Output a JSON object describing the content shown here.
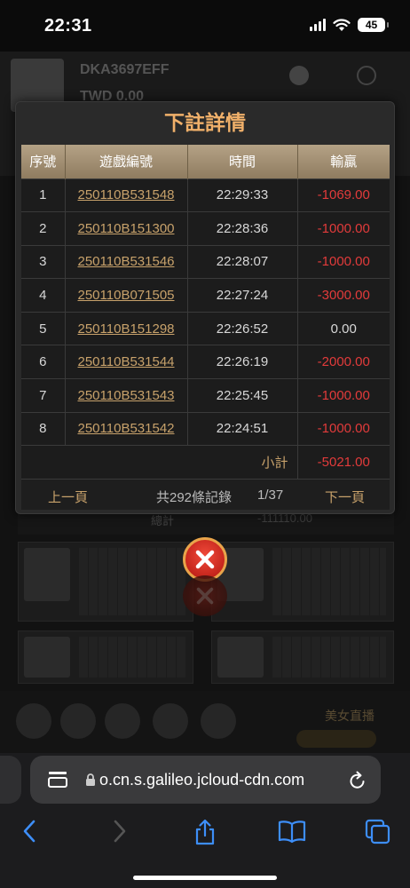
{
  "status_bar": {
    "time": "22:31",
    "battery": "45"
  },
  "background": {
    "username": "DKA3697EFF",
    "balance": "TWD 0.00",
    "total_label": "總計",
    "total_value": "-111110.00",
    "live_label": "美女直播"
  },
  "modal": {
    "title": "下註詳情",
    "columns": [
      "序號",
      "遊戲編號",
      "時間",
      "輸贏"
    ],
    "rows": [
      {
        "no": "1",
        "game_id": "250110B531548",
        "time": "22:29:33",
        "result": "-1069.00"
      },
      {
        "no": "2",
        "game_id": "250110B151300",
        "time": "22:28:36",
        "result": "-1000.00"
      },
      {
        "no": "3",
        "game_id": "250110B531546",
        "time": "22:28:07",
        "result": "-1000.00"
      },
      {
        "no": "4",
        "game_id": "250110B071505",
        "time": "22:27:24",
        "result": "-3000.00"
      },
      {
        "no": "5",
        "game_id": "250110B151298",
        "time": "22:26:52",
        "result": "0.00"
      },
      {
        "no": "6",
        "game_id": "250110B531544",
        "time": "22:26:19",
        "result": "-2000.00"
      },
      {
        "no": "7",
        "game_id": "250110B531543",
        "time": "22:25:45",
        "result": "-1000.00"
      },
      {
        "no": "8",
        "game_id": "250110B531542",
        "time": "22:24:51",
        "result": "-1000.00"
      }
    ],
    "subtotal_label": "小計",
    "subtotal_value": "-5021.00",
    "pager": {
      "prev": "上一頁",
      "total_records": "共292條記錄",
      "page": "1/37",
      "next": "下一頁"
    }
  },
  "browser": {
    "url": "o.cn.s.galileo.jcloud-cdn.com"
  },
  "colors": {
    "accent_gold": "#c8a26b",
    "title_orange": "#f0b06a",
    "negative_red": "#e23b3b",
    "header_bg": "#a08d70"
  },
  "icons": [
    "signal-icon",
    "wifi-icon",
    "battery-icon",
    "close-icon",
    "tabs-icon",
    "lock-icon",
    "reload-icon",
    "back-icon",
    "forward-icon",
    "share-icon",
    "bookmarks-icon",
    "tab-overview-icon"
  ]
}
